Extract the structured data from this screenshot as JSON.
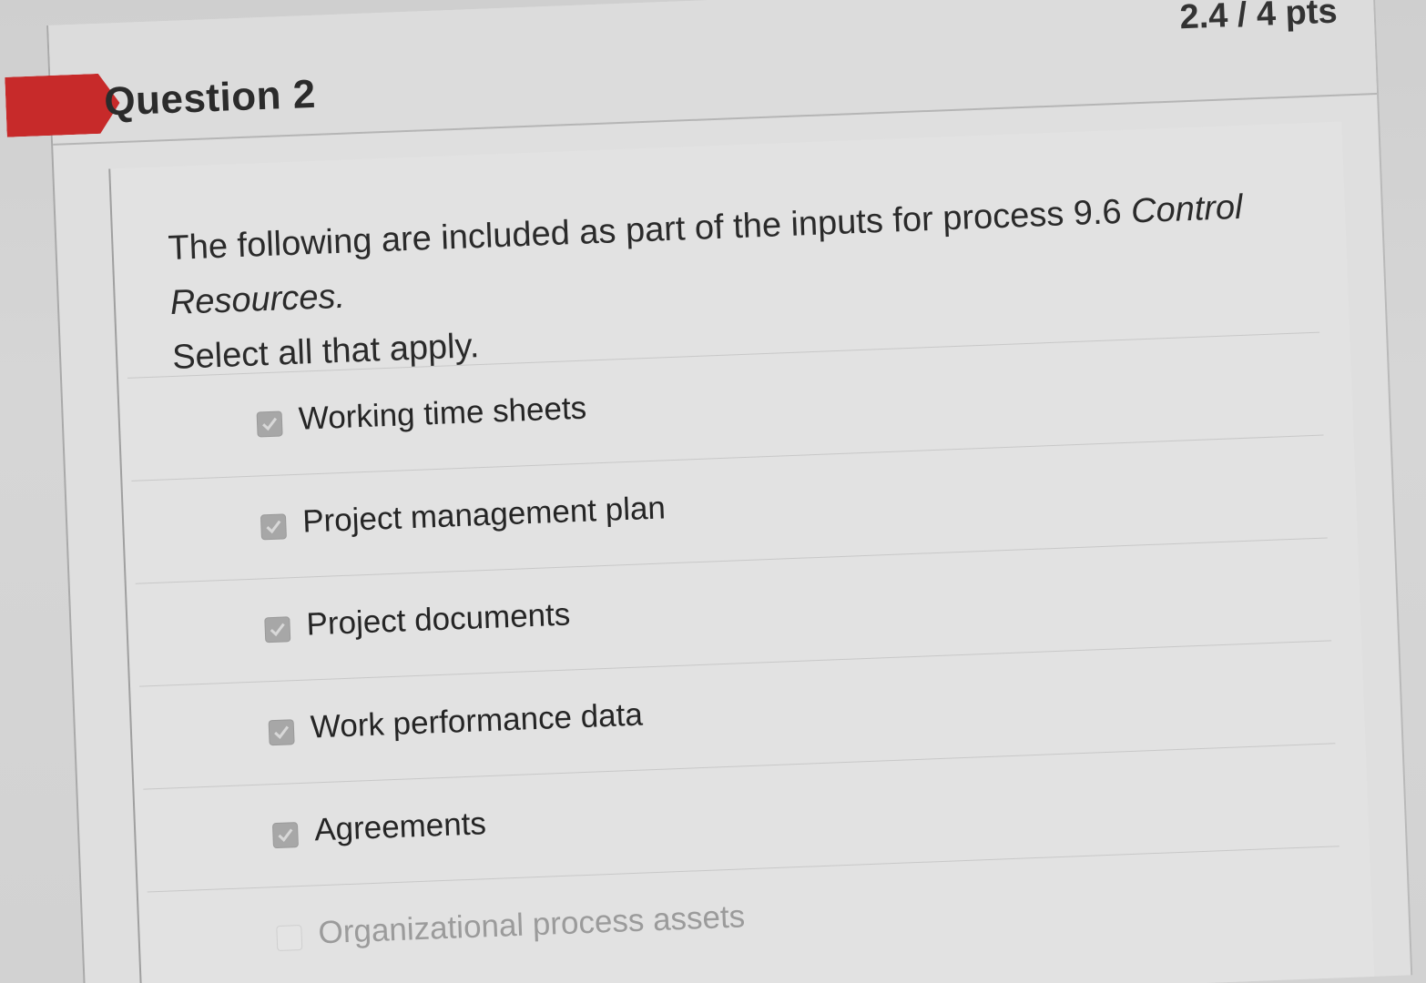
{
  "question": {
    "title": "Question 2",
    "points": "2.4 / 4 pts",
    "text_main": "The following are included as part of the inputs for process 9.6 ",
    "text_emph": "Control Resources.",
    "instruction": "Select all that apply."
  },
  "answers": [
    {
      "label": "Working time sheets",
      "checked": true
    },
    {
      "label": "Project management plan",
      "checked": true
    },
    {
      "label": "Project documents",
      "checked": true
    },
    {
      "label": "Work performance data",
      "checked": true
    },
    {
      "label": "Agreements",
      "checked": true
    },
    {
      "label": "Organizational process assets",
      "checked": false
    }
  ],
  "colors": {
    "accent": "#c72a2a",
    "checkbox_checked": "#a7a7a7"
  }
}
